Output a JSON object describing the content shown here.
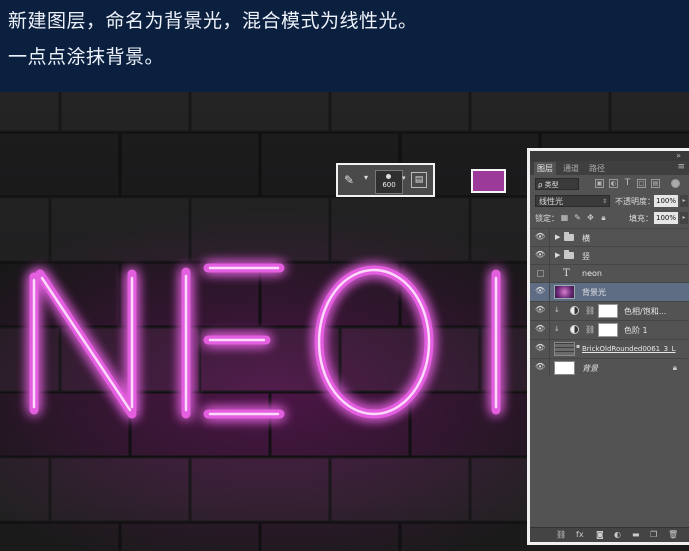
{
  "instructions": {
    "line1": "新建图层，命名为背景光，混合模式为线性光。",
    "line2": "一点点涂抹背景。"
  },
  "canvas": {
    "neon_text": "NEON",
    "neon_color": "#e45ee0",
    "glow_color": "#b02aa6"
  },
  "brush_toolbar": {
    "brush_size": "600",
    "tool_icon": "brush-icon",
    "panel_icon": "brush-panel-icon"
  },
  "foreground_swatch": {
    "color": "#9b3a98"
  },
  "layers_panel": {
    "tabs": [
      "图层",
      "通道",
      "路径"
    ],
    "active_tab": 0,
    "filter_label": "ρ 类型",
    "filter_icons": [
      "image-filter-icon",
      "adjustment-filter-icon",
      "type-filter-icon",
      "shape-filter-icon",
      "smart-object-filter-icon"
    ],
    "blend_mode": "线性光",
    "opacity_label": "不透明度：",
    "opacity_value": "100%",
    "lock_label": "锁定：",
    "fill_label": "填充：",
    "fill_value": "100%",
    "layers": [
      {
        "name": "横",
        "type": "group",
        "visible": true
      },
      {
        "name": "竖",
        "type": "group",
        "visible": true
      },
      {
        "name": "neon",
        "type": "text",
        "visible": false
      },
      {
        "name": "背景光",
        "type": "pixel",
        "visible": true,
        "selected": true
      },
      {
        "name": "色相/饱和...",
        "type": "adjustment",
        "visible": true,
        "clipped": true
      },
      {
        "name": "色阶 1",
        "type": "adjustment",
        "visible": true,
        "clipped": true
      },
      {
        "name": "BrickOldRounded0061_3_L",
        "type": "smart",
        "visible": true
      },
      {
        "name": "背景",
        "type": "background",
        "visible": true,
        "locked": true
      }
    ],
    "bottom_icons": [
      "link-icon",
      "fx-icon",
      "mask-icon",
      "adjustment-icon",
      "folder-icon",
      "new-layer-icon",
      "trash-icon"
    ]
  }
}
